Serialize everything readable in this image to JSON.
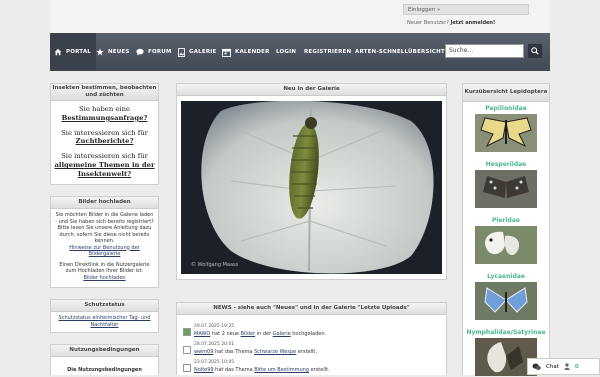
{
  "header": {
    "login_label": "Einloggen »",
    "new_user_text": "Neuer Benutzer?",
    "register_link": "Jetzt anmelden!"
  },
  "nav": {
    "items": [
      "PORTAL",
      "NEUES",
      "FORUM",
      "GALERIE",
      "KALENDER",
      "LOGIN",
      "REGISTRIEREN",
      "ARTEN-SCHNELLÜBERSICHT"
    ],
    "search_placeholder": "Suche..."
  },
  "insect_box": {
    "title": "Insekten bestimmen, beobachten und züchten",
    "p1a": "Sie haben eine",
    "p1b": "Bestimmungsanfrage?",
    "p2a": "Sie interessieren sich für",
    "p2b": "Zuchtberichte?",
    "p3a": "Sie interessieren sich für",
    "p3b": "allgemeine Themen in der Insektenwelt?"
  },
  "upload_box": {
    "title": "Bilder hochladen",
    "text1": "Sie möchten Bilder in die Galerie laden - und Sie haben sich bereits registriert? Bitte lesen Sie unsere Anleitung dazu durch, sofern Sie diese nicht bereits kennen.",
    "link1": "Hinweise zur Benutzung der Bildergalerie",
    "text2": "Einen Direktlink in die Nutzergalerie zum Hochladen Ihrer Bilder ist:",
    "link2": "Bilder hochladen"
  },
  "status_box": {
    "title": "Schutzstatus",
    "link": "Schutzstatus einheimischer Tag- und Nachtfalter"
  },
  "terms_box": {
    "title": "Nutzungsbedingungen",
    "text": "Die Nutzungsbedingungen"
  },
  "gallery": {
    "title": "Neu in der Galerie",
    "watermark": "© Wolfgang Maass"
  },
  "news": {
    "title": "NEWS - siehe auch \"Neues\" und in der Galerie \"Letzte Uploads\"",
    "items": [
      {
        "date": "29.07.2025 19:25",
        "user": "MAWO",
        "t1": " hat 2 neue ",
        "l1": "Bilder",
        "t2": " in der ",
        "l2": "Galerie",
        "t3": " hochgeladen."
      },
      {
        "date": "28.07.2025 20:01",
        "user": "wwm09",
        "t1": " hat das Thema ",
        "l1": "Schwarze Wespe",
        "t2": " erstellt.",
        "l2": "",
        "t3": ""
      },
      {
        "date": "23.07.2025 10:05",
        "user": "Nolte99",
        "t1": " hat das Thema ",
        "l1": "Bitte um Bestimmung",
        "t2": " erstellt.",
        "l2": "",
        "t3": ""
      }
    ]
  },
  "right": {
    "title": "Kurzübersicht Lepidoptera",
    "families": [
      "Papilionidae",
      "Hesperiidae",
      "Pieridae",
      "Lycaenidae",
      "Nymphalidae/Satyrinae"
    ]
  },
  "chat": {
    "label": "Chat",
    "count": "0"
  },
  "colors": {
    "accent": "#4cb68c",
    "nav_bg": "#4b535e",
    "link": "#2a3c6a"
  }
}
